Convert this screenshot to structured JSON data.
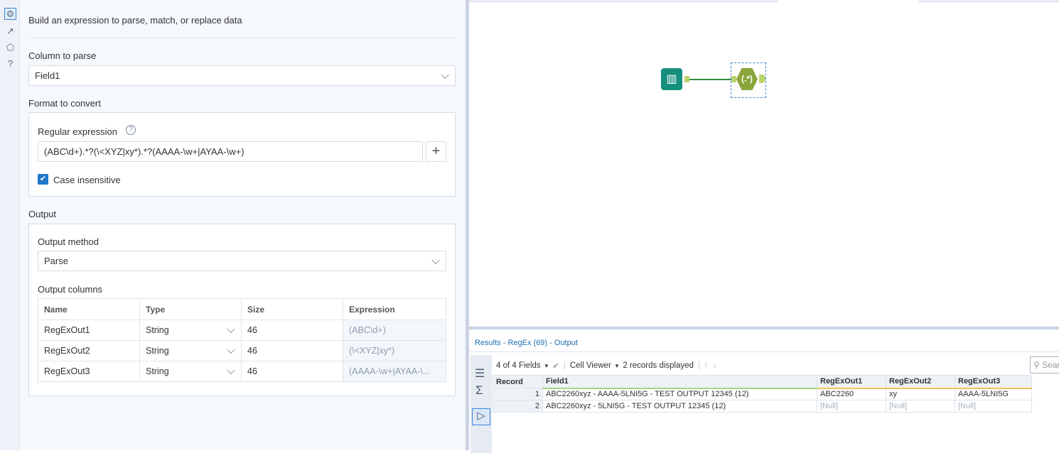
{
  "sidebar": {
    "icons": [
      "gear-icon",
      "connection-icon",
      "tag-icon",
      "help-icon"
    ]
  },
  "config": {
    "description": "Build an expression to parse, match, or replace data",
    "column_label": "Column to parse",
    "column_value": "Field1",
    "format_label": "Format to convert",
    "regex_label": "Regular expression",
    "regex_value": "(ABC\\d+).*?(\\<XYZ|xy*).*?(AAAA-\\w+|AYAA-\\w+)",
    "case_label": "Case insensitive",
    "case_checked": true,
    "output_label": "Output",
    "method_label": "Output method",
    "method_value": "Parse",
    "columns_label": "Output columns",
    "columns_headers": [
      "Name",
      "Type",
      "Size",
      "Expression"
    ],
    "columns_rows": [
      [
        "RegExOut1",
        "String",
        "46",
        "(ABC\\d+)"
      ],
      [
        "RegExOut2",
        "String",
        "46",
        "(\\<XYZ|xy*)"
      ],
      [
        "RegExOut3",
        "String",
        "46",
        "(AAAA-\\w+|AYAA-\\..."
      ]
    ]
  },
  "canvas": {
    "tools": [
      "input-data-tool",
      "regex-tool"
    ],
    "regex_glyph": "(.*)"
  },
  "results": {
    "title": "Results - RegEx (69) - Output",
    "fields": "4 of 4 Fields",
    "viewer": "Cell Viewer",
    "records": "2 records displayed",
    "search_placeholder": "Search",
    "headers": [
      "Record",
      "Field1",
      "RegExOut1",
      "RegExOut2",
      "RegExOut3"
    ],
    "rows": [
      [
        "1",
        "ABC2260xyz - AAAA-5LNI5G - TEST OUTPUT 12345 (12)",
        "ABC2260",
        "xy",
        "AAAA-5LNI5G"
      ],
      [
        "2",
        "ABC2260xyz - 5LNI5G - TEST OUTPUT 12345 (12)",
        "[Null]",
        "[Null]",
        "[Null]"
      ]
    ]
  },
  "colors": {
    "accent": "#1f78c8",
    "regex_tool": "#8aa63a",
    "input_tool": "#16907d"
  }
}
